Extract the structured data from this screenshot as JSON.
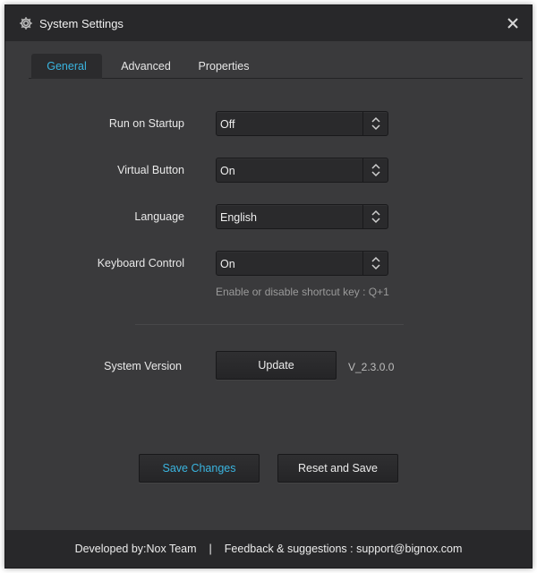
{
  "window": {
    "title": "System Settings",
    "icon": "gear-icon",
    "close_icon": "close-icon"
  },
  "tabs": [
    {
      "label": "General",
      "active": true
    },
    {
      "label": "Advanced",
      "active": false
    },
    {
      "label": "Properties",
      "active": false
    }
  ],
  "settings": [
    {
      "label": "Run on Startup",
      "value": "Off"
    },
    {
      "label": "Virtual Button",
      "value": "On"
    },
    {
      "label": "Language",
      "value": "English"
    },
    {
      "label": "Keyboard Control",
      "value": "On"
    }
  ],
  "keyboard_hint": "Enable or disable shortcut key : Q+1",
  "system_version": {
    "label": "System Version",
    "button_label": "Update",
    "version": "V_2.3.0.0"
  },
  "actions": {
    "save_label": "Save Changes",
    "reset_label": "Reset and Save"
  },
  "footer": {
    "developer": "Developed by:Nox Team",
    "separator": "|",
    "feedback": "Feedback & suggestions : support@bignox.com"
  },
  "colors": {
    "accent": "#3ab5e0",
    "background": "#3a3a3c",
    "titlebar": "#28282a"
  }
}
